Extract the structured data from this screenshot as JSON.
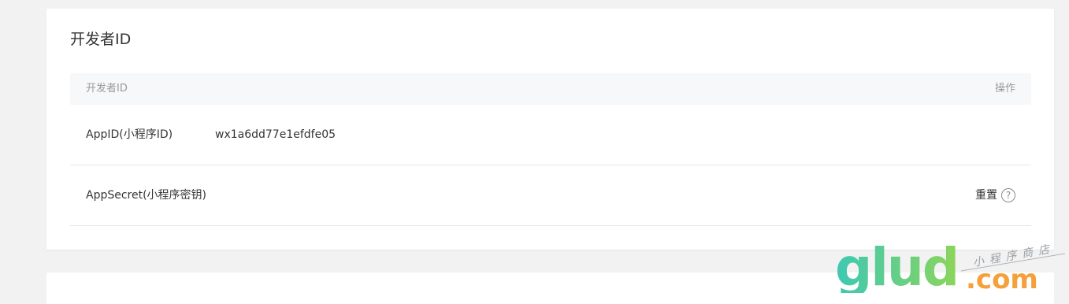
{
  "card": {
    "title": "开发者ID"
  },
  "table": {
    "headers": {
      "id": "开发者ID",
      "action": "操作"
    },
    "rows": [
      {
        "label": "AppID(小程序ID)",
        "value": "wx1a6dd77e1efdfe05",
        "action": ""
      },
      {
        "label": "AppSecret(小程序密钥)",
        "value": "",
        "action": "重置"
      }
    ]
  },
  "help_icon_glyph": "?",
  "watermark": {
    "brand": "glud",
    "domain": ".com",
    "tagline": "小程序商店"
  },
  "colors": {
    "watermark_green_start": "#3ec8b4",
    "watermark_green_end": "#8cd55a",
    "watermark_orange": "#f5a03a",
    "watermark_tagline": "#9aa0a6"
  }
}
